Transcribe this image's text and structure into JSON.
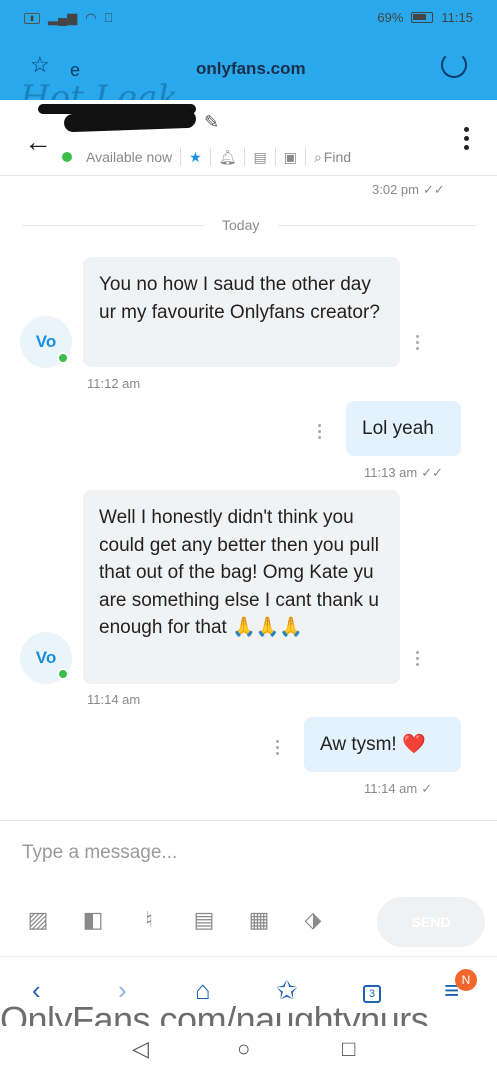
{
  "status_bar": {
    "battery": "69%",
    "time": "11:15"
  },
  "browser": {
    "url": "onlyfans.com",
    "watermark_script": "Hot Leak"
  },
  "chat_header": {
    "availability": "Available now",
    "find_label": "Find"
  },
  "messages": {
    "prev_time": "3:02 pm",
    "today_label": "Today",
    "m1_text": "You no how I saud the other day ur my favourite Onlyfans creator?",
    "m1_avatar": "Vo",
    "m1_time": "11:12 am",
    "m2_text": "Lol yeah",
    "m2_time": "11:13 am",
    "m3_text": "Well I honestly didn't think you could get any better then you pull that out of the bag! Omg Kate yu are something else I cant thank u enough for that 🙏🙏🙏",
    "m3_avatar": "Vo",
    "m3_time": "11:14 am",
    "m4_text": "Aw tysm! ❤️",
    "m4_time": "11:14 am"
  },
  "composer": {
    "placeholder": "Type a message...",
    "send_label": "SEND"
  },
  "browser_nav": {
    "tab_count": "3",
    "notif_badge": "N"
  },
  "watermark": "OnlyFans.com/naughtynurs",
  "colors": {
    "brand_blue": "#29a9eb",
    "incoming_bubble": "#f1f2f3",
    "outgoing_bubble": "#e3f2fd",
    "online_green": "#3cbf4a"
  }
}
